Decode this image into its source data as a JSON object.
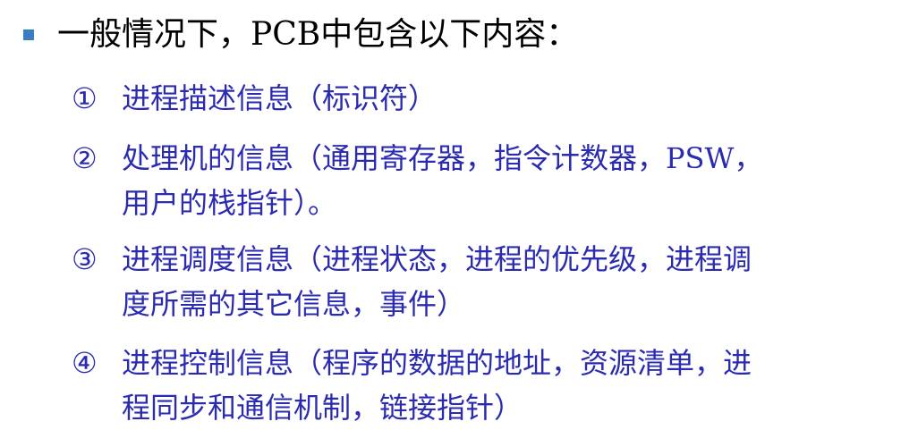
{
  "heading": "一般情况下，PCB中包含以下内容：",
  "items": [
    {
      "num": "①",
      "lines": [
        "进程描述信息（标识符）"
      ]
    },
    {
      "num": "②",
      "lines": [
        "处理机的信息（通用寄存器，指令计数器，PSW，",
        "用户的栈指针）。"
      ]
    },
    {
      "num": "③",
      "lines": [
        "进程调度信息（进程状态，进程的优先级，进程调",
        "度所需的其它信息，事件）"
      ]
    },
    {
      "num": "④",
      "lines": [
        "进程控制信息（程序的数据的地址，资源清单，进",
        "程同步和通信机制，链接指针）"
      ]
    }
  ],
  "colors": {
    "bullet": "#3b7dbf",
    "heading_text": "#000000",
    "item_text": "#2b2bb2"
  }
}
